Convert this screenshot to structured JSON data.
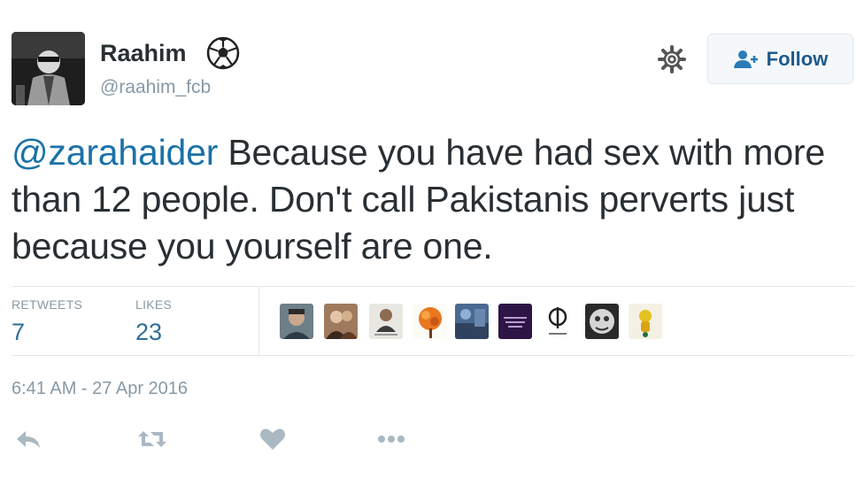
{
  "user": {
    "name": "Raahim",
    "handle": "@raahim_fcb",
    "follow_label": "Follow"
  },
  "tweet": {
    "mention": "@zarahaider",
    "text": " Because you have had sex with more than 12 people. Don't call Pakistanis perverts just because you yourself are one."
  },
  "stats": {
    "retweets_label": "RETWEETS",
    "retweets_value": "7",
    "likes_label": "LIKES",
    "likes_value": "23"
  },
  "likers": [
    {
      "icon": "liker-avatar-1"
    },
    {
      "icon": "liker-avatar-2"
    },
    {
      "icon": "liker-avatar-3"
    },
    {
      "icon": "liker-avatar-4"
    },
    {
      "icon": "liker-avatar-5"
    },
    {
      "icon": "liker-avatar-6"
    },
    {
      "icon": "liker-avatar-7"
    },
    {
      "icon": "liker-avatar-8"
    },
    {
      "icon": "liker-avatar-9"
    }
  ],
  "timestamp": "6:41 AM - 27 Apr 2016",
  "actions": [
    "reply-icon",
    "retweet-icon",
    "like-icon",
    "more-icon"
  ],
  "colors": {
    "link": "#1b72a8",
    "text": "#292f33",
    "muted": "#8899a6",
    "stat": "#2f6e99",
    "divider": "#e1e8ed"
  }
}
